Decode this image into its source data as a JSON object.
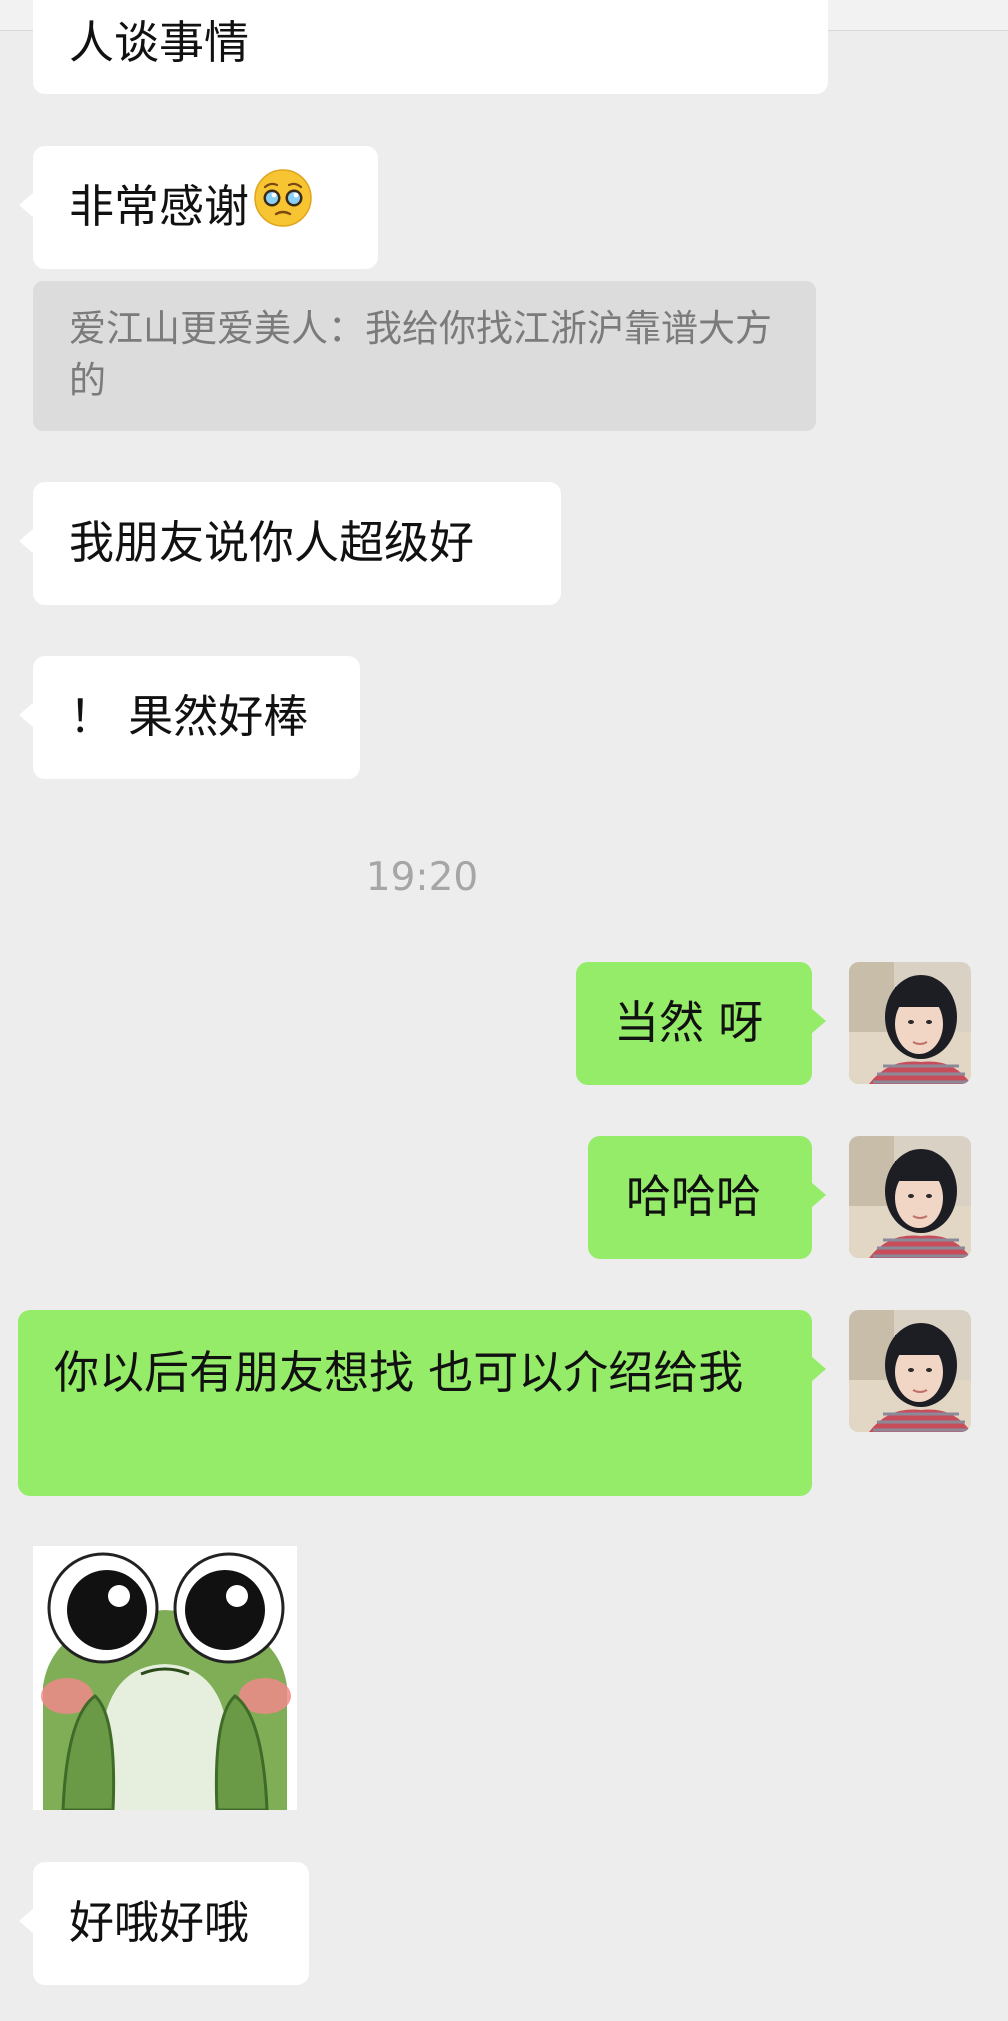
{
  "messages": {
    "partial_top": "人谈事情",
    "thanks": "非常感谢",
    "quote": "爱江山更爱美人：我给你找江浙沪靠谱大方的",
    "friend_said": "我朋友说你人超级好",
    "great": "！ 果然好棒",
    "timestamp": "19:20",
    "of_course": "当然 呀",
    "haha": "哈哈哈",
    "intro": "你以后有朋友想找 也可以介绍给我",
    "ok": "好哦好哦"
  },
  "icons": {
    "thanks_emoji": "pleading-face-emoji",
    "avatar": "user-avatar-photo",
    "sticker": "frog-sticker"
  },
  "colors": {
    "background": "#ededed",
    "incoming_bubble": "#ffffff",
    "outgoing_bubble": "#95ec69",
    "quote_bg": "#dcdcdc",
    "quote_text": "#7b7b7b",
    "timestamp_text": "#a6a6a6"
  }
}
